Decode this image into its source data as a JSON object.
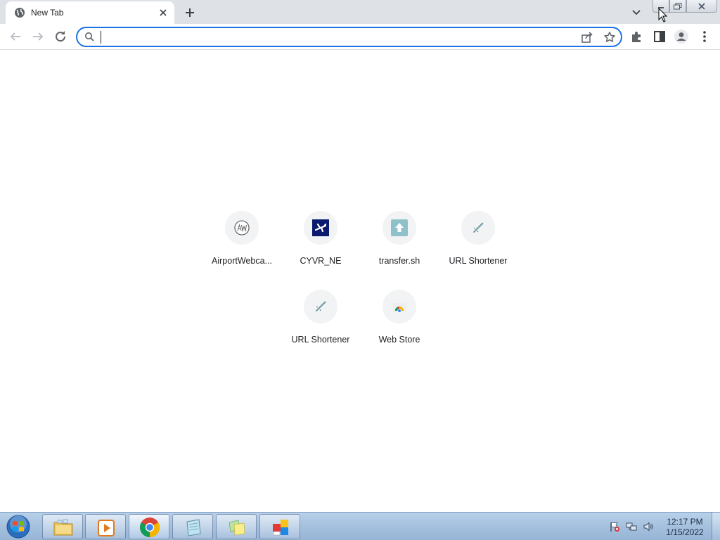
{
  "browser": {
    "tab": {
      "title": "New Tab",
      "favicon": "globe-icon",
      "close_icon": "close-icon"
    },
    "new_tab_icon": "plus-icon",
    "tab_search_icon": "chevron-down-icon",
    "window_controls": [
      "minimize-icon",
      "restore-icon",
      "close-icon"
    ],
    "toolbar": {
      "back_icon": "arrow-left-icon",
      "forward_icon": "arrow-right-icon",
      "reload_icon": "reload-icon",
      "extensions_icon": "puzzle-icon",
      "side_panel_icon": "side-panel-icon",
      "profile_icon": "profile-icon",
      "menu_icon": "kebab-menu-icon"
    },
    "omnibox": {
      "value": "",
      "placeholder": "",
      "share_icon": "share-icon",
      "bookmark_icon": "star-icon"
    }
  },
  "shortcuts": [
    {
      "label": "AirportWebca...",
      "icon": "airportwebcams-icon"
    },
    {
      "label": "CYVR_NE",
      "icon": "airplane-icon"
    },
    {
      "label": "transfer.sh",
      "icon": "upload-arrow-icon"
    },
    {
      "label": "URL Shortener",
      "icon": "rocket-icon"
    },
    {
      "label": "URL Shortener",
      "icon": "rocket-icon"
    },
    {
      "label": "Web Store",
      "icon": "chrome-web-store-icon"
    }
  ],
  "taskbar": {
    "start_icon": "windows-start-icon",
    "items": [
      {
        "name": "file-explorer",
        "icon": "folder-icon"
      },
      {
        "name": "media-player",
        "icon": "media-player-icon"
      },
      {
        "name": "chrome",
        "icon": "chrome-icon"
      },
      {
        "name": "notepad",
        "icon": "notepad-icon"
      },
      {
        "name": "sticky-notes",
        "icon": "sticky-notes-icon"
      },
      {
        "name": "paint",
        "icon": "paint-icon"
      }
    ],
    "tray": {
      "icons": [
        "action-center-flag-icon",
        "network-icon",
        "volume-icon"
      ],
      "time": "12:17 PM",
      "date": "1/15/2022"
    }
  },
  "colors": {
    "accent": "#1a73e8",
    "tab_strip": "#dee1e6",
    "text": "#202124",
    "icon": "#5f6368"
  }
}
